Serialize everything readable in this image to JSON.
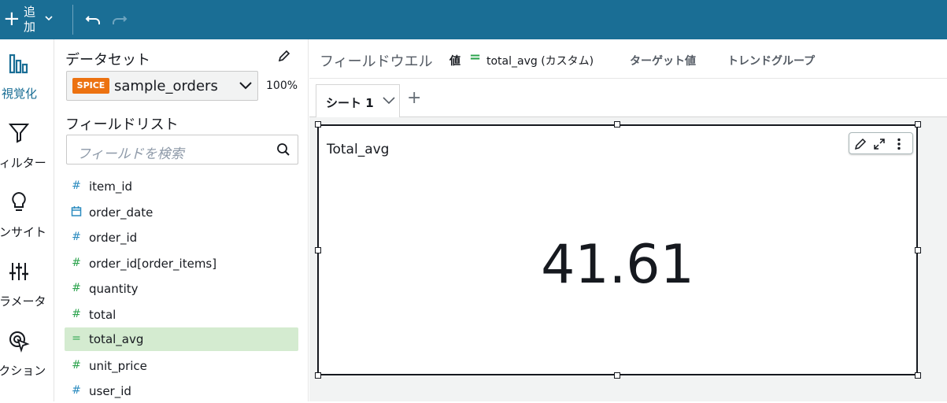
{
  "topbar": {
    "add_label": "追加",
    "undo_icon": "undo-icon",
    "redo_icon": "redo-icon"
  },
  "leftnav": {
    "items": [
      {
        "label": "視覚化",
        "icon": "bar-chart-icon"
      },
      {
        "label": "フィルター",
        "icon": "filter-icon"
      },
      {
        "label": "インサイト",
        "icon": "lightbulb-icon"
      },
      {
        "label": "パラメータ",
        "icon": "sliders-icon"
      },
      {
        "label": "アクション",
        "icon": "target-cursor-icon"
      }
    ]
  },
  "dataset": {
    "title": "データセット",
    "badge": "SPICE",
    "name": "sample_orders",
    "percent": "100%"
  },
  "fieldlist": {
    "title": "フィールドリスト",
    "search_placeholder": "フィールドを検索",
    "fields": [
      {
        "name": "item_id",
        "icon": "#",
        "kind": "dimension"
      },
      {
        "name": "order_date",
        "icon": "calendar-icon",
        "kind": "dimension"
      },
      {
        "name": "order_id",
        "icon": "#",
        "kind": "dimension"
      },
      {
        "name": "order_id[order_items]",
        "icon": "#",
        "kind": "measure"
      },
      {
        "name": "quantity",
        "icon": "#",
        "kind": "measure"
      },
      {
        "name": "total",
        "icon": "#",
        "kind": "measure"
      },
      {
        "name": "total_avg",
        "icon": "=",
        "kind": "calculated",
        "selected": true
      },
      {
        "name": "unit_price",
        "icon": "#",
        "kind": "measure"
      },
      {
        "name": "user_id",
        "icon": "#",
        "kind": "dimension"
      }
    ]
  },
  "fieldwell": {
    "title": "フィールドウエル",
    "value_label": "値",
    "value": "total_avg (カスタム)",
    "target_label": "ターゲット値",
    "trend_label": "トレンドグループ"
  },
  "sheets": {
    "tabs": [
      {
        "label": "シート 1"
      }
    ]
  },
  "visual": {
    "title": "Total_avg",
    "kpi_value": "41.61"
  },
  "colors": {
    "topbar": "#1a6e95",
    "accent": "#1a6e95",
    "spice": "#ec7211",
    "measure": "#2da44e",
    "dimension": "#2b8bbf",
    "selected_field_bg": "#d4ebd0"
  }
}
